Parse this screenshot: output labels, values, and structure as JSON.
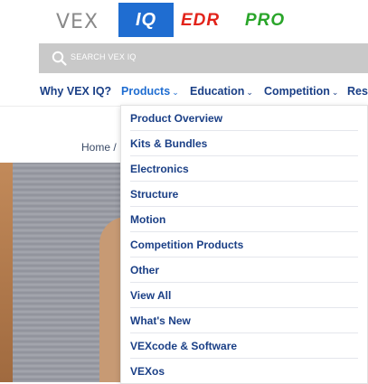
{
  "brand": {
    "vex_label": "VEX",
    "tabs": [
      {
        "label": "IQ",
        "active": true,
        "color": "#1f6dd1"
      },
      {
        "label": "EDR",
        "active": false,
        "color": "#e2231a"
      },
      {
        "label": "PRO",
        "active": false,
        "color": "#2aa52a"
      }
    ]
  },
  "search": {
    "placeholder": "SEARCH VEX IQ",
    "icon": "search-icon"
  },
  "nav": {
    "items": [
      {
        "label": "Why VEX IQ?",
        "has_dropdown": false
      },
      {
        "label": "Products",
        "has_dropdown": true,
        "open": true
      },
      {
        "label": "Education",
        "has_dropdown": true
      },
      {
        "label": "Competition",
        "has_dropdown": true
      },
      {
        "label": "Res",
        "has_dropdown": false
      }
    ],
    "chevron": "⌄"
  },
  "breadcrumb": {
    "home": "Home",
    "separator": "/"
  },
  "products_menu": {
    "items": [
      "Product Overview",
      "Kits & Bundles",
      "Electronics",
      "Structure",
      "Motion",
      "Competition Products",
      "Other",
      "View All",
      "What's New",
      "VEXcode & Software",
      "VEXos"
    ]
  },
  "colors": {
    "nav_text": "#1a3f86",
    "active_tab": "#1f6dd1",
    "search_bg": "#c9c9c9"
  }
}
